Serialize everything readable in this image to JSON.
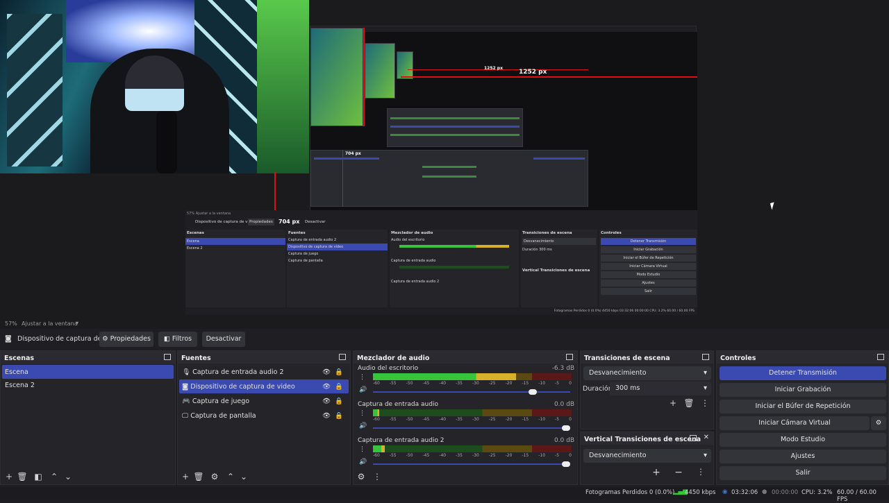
{
  "window": {
    "minimize": "–",
    "maximize": "❐",
    "close": "✕"
  },
  "preview": {
    "nested_labels": {
      "px1252": "1252 px",
      "px704": "704 px",
      "px1252_small": "1252 px",
      "px704_small": "704 px"
    },
    "nested_ui": {
      "source_name": "Dispositivo de captura de v",
      "props": "Propiedades",
      "deactivate": "Desactivar",
      "zoom": "57%  Ajustar a la ventana",
      "scenes_title": "Escenas",
      "sources_title": "Fuentes",
      "mixer_title": "Mezclador de audio",
      "trans_title": "Transiciones de escena",
      "controls_title": "Controles",
      "scene_items": [
        "Escena",
        "Escena 2"
      ],
      "source_items": [
        "Captura de entrada audio 2",
        "Dispositivo de captura de vídeo",
        "Captura de juego",
        "Captura de pantalla"
      ],
      "mixer_channels": [
        "Audio del escritorio",
        "Captura de entrada audio",
        "Captura de entrada audio 2"
      ],
      "trans_value": "Desvanecimiento",
      "duration_label": "Duración",
      "duration_value": "300 ms",
      "vtrans_title": "Vertical Transiciones de escena",
      "controls": [
        "Detener Transmisión",
        "Iniciar Grabación",
        "Iniciar el Búfer de Repetición",
        "Iniciar Cámara Virtual",
        "Modo Estudio",
        "Ajustes",
        "Salir"
      ],
      "status": "Fotogramas Perdidos 0 (0.0%)   4450 kbps   03:32:06   00:00:00   CPU: 3.2%   60.00 / 60.00 FPS"
    }
  },
  "zoombar": {
    "zoom": "57%",
    "mode": "Ajustar a la ventana"
  },
  "sourcebar": {
    "source_name": "Dispositivo de captura de v",
    "properties": "Propiedades",
    "filters": "Filtros",
    "deactivate": "Desactivar"
  },
  "scenes": {
    "title": "Escenas",
    "items": [
      "Escena",
      "Escena 2"
    ]
  },
  "sources": {
    "title": "Fuentes",
    "items": [
      {
        "label": "Captura de entrada audio 2",
        "icon": "microphone-icon"
      },
      {
        "label": "Dispositivo de captura de video",
        "icon": "camera-icon"
      },
      {
        "label": "Captura de juego",
        "icon": "gamepad-icon"
      },
      {
        "label": "Captura de pantalla",
        "icon": "monitor-icon"
      }
    ]
  },
  "mixer": {
    "title": "Mezclador de audio",
    "ticks": [
      "-60",
      "-55",
      "-50",
      "-45",
      "-40",
      "-35",
      "-30",
      "-25",
      "-20",
      "-15",
      "-10",
      "-5",
      "0"
    ],
    "channels": [
      {
        "name": "Audio del escritorio",
        "db": "-6.3 dB",
        "level": 0.72,
        "volume": 0.83
      },
      {
        "name": "Captura de entrada audio",
        "db": "0.0 dB",
        "level": 0.03,
        "volume": 1.0
      },
      {
        "name": "Captura de entrada audio 2",
        "db": "0.0 dB",
        "level": 0.06,
        "volume": 1.0
      }
    ]
  },
  "transitions": {
    "title": "Transiciones de escena",
    "selected": "Desvanecimiento",
    "duration_label": "Duración",
    "duration_value": "300 ms",
    "vertical_title": "Vertical Transiciones de escena",
    "vertical_selected": "Desvanecimiento"
  },
  "controls": {
    "title": "Controles",
    "stop_stream": "Detener Transmisión",
    "start_recording": "Iniciar Grabación",
    "replay_buffer": "Iniciar el Búfer de Repetición",
    "virtual_cam": "Iniciar Cámara Virtual",
    "studio_mode": "Modo Estudio",
    "settings": "Ajustes",
    "exit": "Salir"
  },
  "status": {
    "dropped": "Fotogramas Perdidos 0 (0.0%)",
    "bitrate": "4450 kbps",
    "stream_time": "03:32:06",
    "rec_time": "00:00:00",
    "cpu": "CPU: 3.2%",
    "fps": "60.00 / 60.00 FPS"
  },
  "colors": {
    "accent": "#3b4ab1",
    "panel": "#242429",
    "meter_green": "#38c43a",
    "meter_yellow": "#d8b12a",
    "meter_red": "#d11"
  }
}
